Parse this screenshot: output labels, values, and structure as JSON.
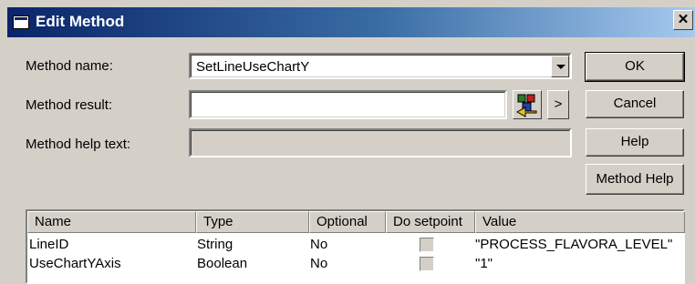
{
  "window": {
    "title": "Edit Method",
    "close_glyph": "✕"
  },
  "form": {
    "method_name_label": "Method name:",
    "method_name_value": "SetLineUseChartY",
    "method_result_label": "Method result:",
    "method_result_value": "",
    "method_help_label": "Method help text:",
    "method_help_value": ""
  },
  "buttons": {
    "ok": "OK",
    "cancel": "Cancel",
    "help": "Help",
    "method_help": "Method Help",
    "browse_arrow": ">"
  },
  "table": {
    "headers": [
      "Name",
      "Type",
      "Optional",
      "Do setpoint",
      "Value"
    ],
    "rows": [
      {
        "name": "LineID",
        "type": "String",
        "optional": "No",
        "value": "\"PROCESS_FLAVORA_LEVEL\""
      },
      {
        "name": "UseChartYAxis",
        "type": "Boolean",
        "optional": "No",
        "value": "\"1\""
      }
    ]
  }
}
